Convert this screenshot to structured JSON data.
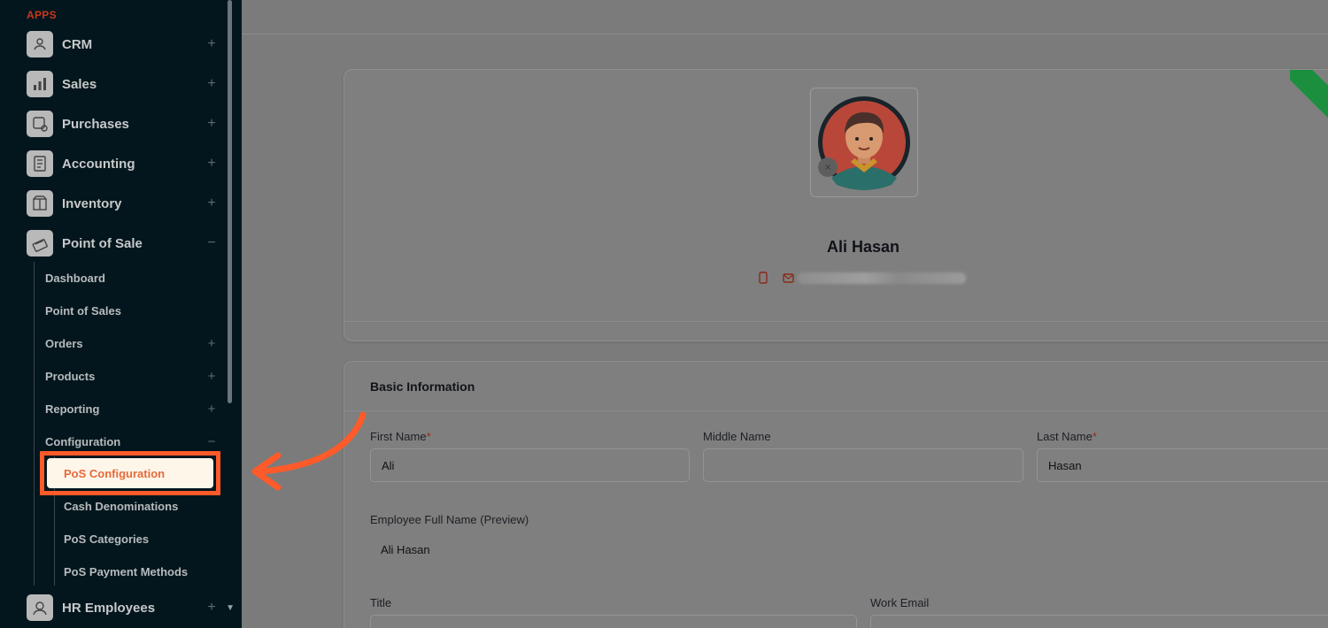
{
  "sidebar": {
    "section_label": "APPS",
    "apps": [
      {
        "label": "CRM",
        "icon": "crm-icon",
        "toggle": "+"
      },
      {
        "label": "Sales",
        "icon": "sales-chart-icon",
        "toggle": "+"
      },
      {
        "label": "Purchases",
        "icon": "purchases-icon",
        "toggle": "+"
      },
      {
        "label": "Accounting",
        "icon": "accounting-icon",
        "toggle": "+"
      },
      {
        "label": "Inventory",
        "icon": "inventory-box-icon",
        "toggle": "+"
      },
      {
        "label": "Point of Sale",
        "icon": "point-of-sale-icon",
        "toggle": "−"
      }
    ],
    "pos_items": [
      {
        "label": "Dashboard",
        "toggle": ""
      },
      {
        "label": "Point of Sales",
        "toggle": ""
      },
      {
        "label": "Orders",
        "toggle": "+"
      },
      {
        "label": "Products",
        "toggle": "+"
      },
      {
        "label": "Reporting",
        "toggle": "+"
      },
      {
        "label": "Configuration",
        "toggle": "−"
      }
    ],
    "config_items": {
      "active": "PoS Configuration",
      "others": [
        "Cash Denominations",
        "PoS Categories",
        "PoS Payment Methods"
      ]
    },
    "hr": {
      "label": "HR Employees",
      "toggle": "+"
    }
  },
  "profile": {
    "name": "Ali Hasan"
  },
  "basic_info": {
    "title": "Basic Information",
    "first_name_label": "First Name",
    "first_name_value": "Ali",
    "middle_name_label": "Middle Name",
    "middle_name_value": "",
    "last_name_label": "Last Name",
    "last_name_value": "Hasan",
    "required_mark": "*",
    "full_name_label": "Employee Full Name (Preview)",
    "full_name_value": "Ali Hasan",
    "title_label": "Title",
    "work_email_label": "Work Email"
  },
  "colors": {
    "sidebar_bg": "#04161d",
    "highlight": "#ff5a2a",
    "active_bg": "#fff6ea",
    "ribbon": "#1c8f3f"
  }
}
